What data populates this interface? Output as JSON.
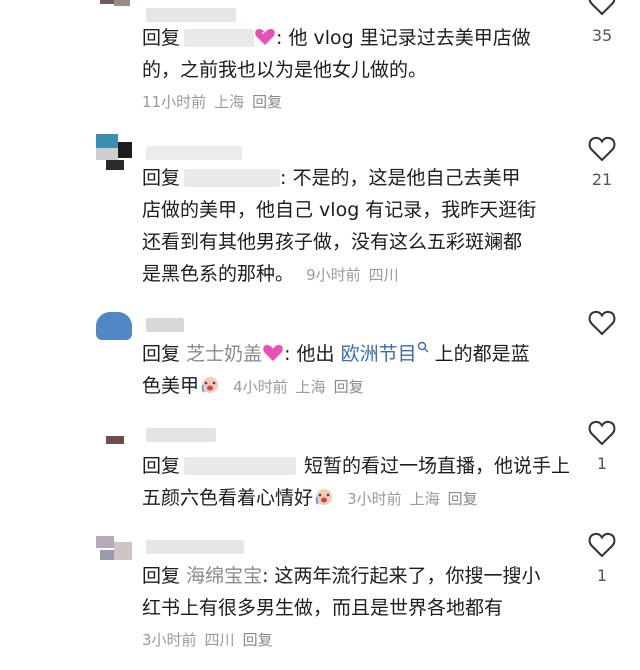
{
  "comments": [
    {
      "reply_kw": "回复",
      "reply_to": "",
      "text": ": 他 vlog 里记录过去美甲店做的，之前我也以为是他女儿做的。",
      "line1": ": 他 vlog 里记录过去美甲店做",
      "line2": "的，之前我也以为是他女儿做的。",
      "time": "11小时前",
      "location": "上海",
      "reply_label": "回复",
      "likes": "35"
    },
    {
      "reply_kw": "回复",
      "reply_to": "",
      "line1": ": 不是的，这是他自己去美甲",
      "line2": "店做的美甲，他自己 vlog 有记录，我昨天逛街",
      "line3": "还看到有其他男孩子做，没有这么五彩斑斓都",
      "line4": "是黑色系的那种。",
      "time": "9小时前",
      "location": "四川",
      "reply_label": "回复",
      "likes": "21"
    },
    {
      "reply_kw": "回复",
      "reply_to": "芝士奶盖",
      "line1_a": ": 他出 ",
      "link": "欧洲节目",
      "line1_b": " 上的都是蓝",
      "line2": "色美甲",
      "time": "4小时前",
      "location": "上海",
      "reply_label": "回复",
      "likes": ""
    },
    {
      "reply_kw": "回复",
      "reply_to": "",
      "line1": "短暂的看过一场直播，他说手上",
      "line2": "五颜六色看着心情好",
      "time": "3小时前",
      "location": "上海",
      "reply_label": "回复",
      "likes": "1"
    },
    {
      "reply_kw": "回复",
      "reply_to": "海绵宝宝",
      "line1": ": 这两年流行起来了，你搜一搜小",
      "line2": "红书上有很多男生做，而且是世界各地都有",
      "time": "3小时前",
      "location": "四川",
      "reply_label": "回复",
      "likes": "1"
    }
  ],
  "colors": {
    "meta": "#9a9a9a",
    "link": "#3a6bb3",
    "heart_emoji": "#e94fb6"
  },
  "icons": [
    "heart-outline-icon",
    "pink-heart-emoji",
    "crying-face-emoji",
    "search-icon"
  ]
}
